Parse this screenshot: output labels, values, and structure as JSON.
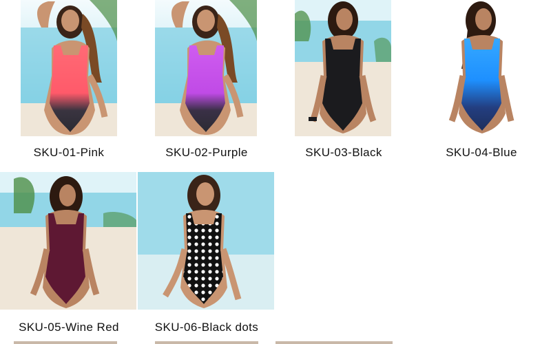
{
  "products": [
    {
      "sku": "SKU-01-Pink",
      "swimsuit_top": "#ff5a6a",
      "swimsuit_bottom": "#2b2b33",
      "pattern": "gradient"
    },
    {
      "sku": "SKU-02-Purple",
      "swimsuit_top": "#c04be6",
      "swimsuit_bottom": "#2b2b33",
      "pattern": "gradient"
    },
    {
      "sku": "SKU-03-Black",
      "swimsuit_top": "#1b1b1e",
      "swimsuit_bottom": "#1b1b1e",
      "pattern": "solid"
    },
    {
      "sku": "SKU-04-Blue",
      "swimsuit_top": "#1e90ff",
      "swimsuit_bottom": "#1e2f5c",
      "pattern": "gradient"
    },
    {
      "sku": "SKU-05-Wine Red",
      "swimsuit_top": "#5e1833",
      "swimsuit_bottom": "#5e1833",
      "pattern": "solid"
    },
    {
      "sku": "SKU-06-Black dots",
      "swimsuit_top": "#111111",
      "swimsuit_bottom": "#111111",
      "pattern": "polka-dots"
    }
  ],
  "colors": {
    "sea": "#5fc3dc",
    "sky": "#d8f1f8",
    "sand": "#efe6d8",
    "skin": "#c99572",
    "hair": "#3a2418"
  }
}
